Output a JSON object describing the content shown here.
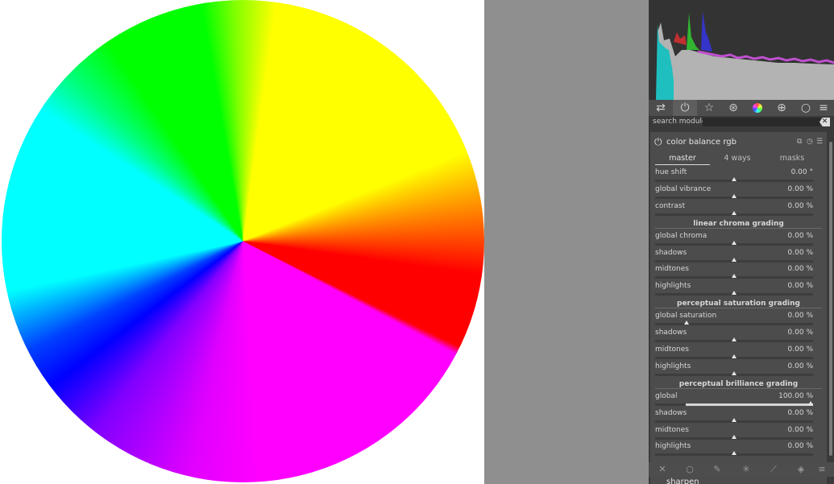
{
  "search": {
    "label": "search module",
    "placeholder": ""
  },
  "module": {
    "title": "color balance rgb",
    "tabs": [
      {
        "label": "master"
      },
      {
        "label": "4 ways"
      },
      {
        "label": "masks"
      }
    ],
    "sliders": {
      "hue_shift": {
        "label": "hue shift",
        "value": "0.00 °",
        "level": 0.5
      },
      "global_vibrance": {
        "label": "global vibrance",
        "value": "0.00 %",
        "level": 0.5
      },
      "contrast": {
        "label": "contrast",
        "value": "0.00 %",
        "level": 0.5
      },
      "chroma_global": {
        "label": "global chroma",
        "value": "0.00 %",
        "level": 0.5
      },
      "chroma_shadows": {
        "label": "shadows",
        "value": "0.00 %",
        "level": 0.5
      },
      "chroma_midtones": {
        "label": "midtones",
        "value": "0.00 %",
        "level": 0.5
      },
      "chroma_highlights": {
        "label": "highlights",
        "value": "0.00 %",
        "level": 0.5
      },
      "sat_global": {
        "label": "global saturation",
        "value": "0.00 %",
        "level": 0.2
      },
      "sat_shadows": {
        "label": "shadows",
        "value": "0.00 %",
        "level": 0.5
      },
      "sat_midtones": {
        "label": "midtones",
        "value": "0.00 %",
        "level": 0.5
      },
      "sat_highlights": {
        "label": "highlights",
        "value": "0.00 %",
        "level": 0.5
      },
      "bri_global": {
        "label": "global",
        "value": "100.00 %",
        "level": 1.0
      },
      "bri_shadows": {
        "label": "shadows",
        "value": "0.00 %",
        "level": 0.5
      },
      "bri_midtones": {
        "label": "midtones",
        "value": "0.00 %",
        "level": 0.5
      },
      "bri_highlights": {
        "label": "highlights",
        "value": "0.00 %",
        "level": 0.5
      }
    },
    "sections": {
      "linear_chroma": "linear chroma grading",
      "perceptual_saturation": "perceptual saturation grading",
      "perceptual_brilliance": "perceptual brilliance grading"
    }
  },
  "next_module": {
    "title": "sharpen"
  },
  "icons": {
    "group_bar": [
      "sliders-icon",
      "power-icon",
      "star-icon",
      "arrow-circle-icon",
      "color-ball-icon",
      "aperture-icon",
      "circle-icon",
      "menu-icon"
    ],
    "bottom_toolbar": [
      "off-icon",
      "circle-mask-icon",
      "brush-icon",
      "drawn-parametric-icon",
      "parametric-icon",
      "raster-mask-icon",
      "presets-menu-icon"
    ]
  },
  "colors": {
    "panel_bg": "#3a3a3a",
    "module_bg": "#4c4c4c",
    "center_gray": "#8f8f8f"
  }
}
